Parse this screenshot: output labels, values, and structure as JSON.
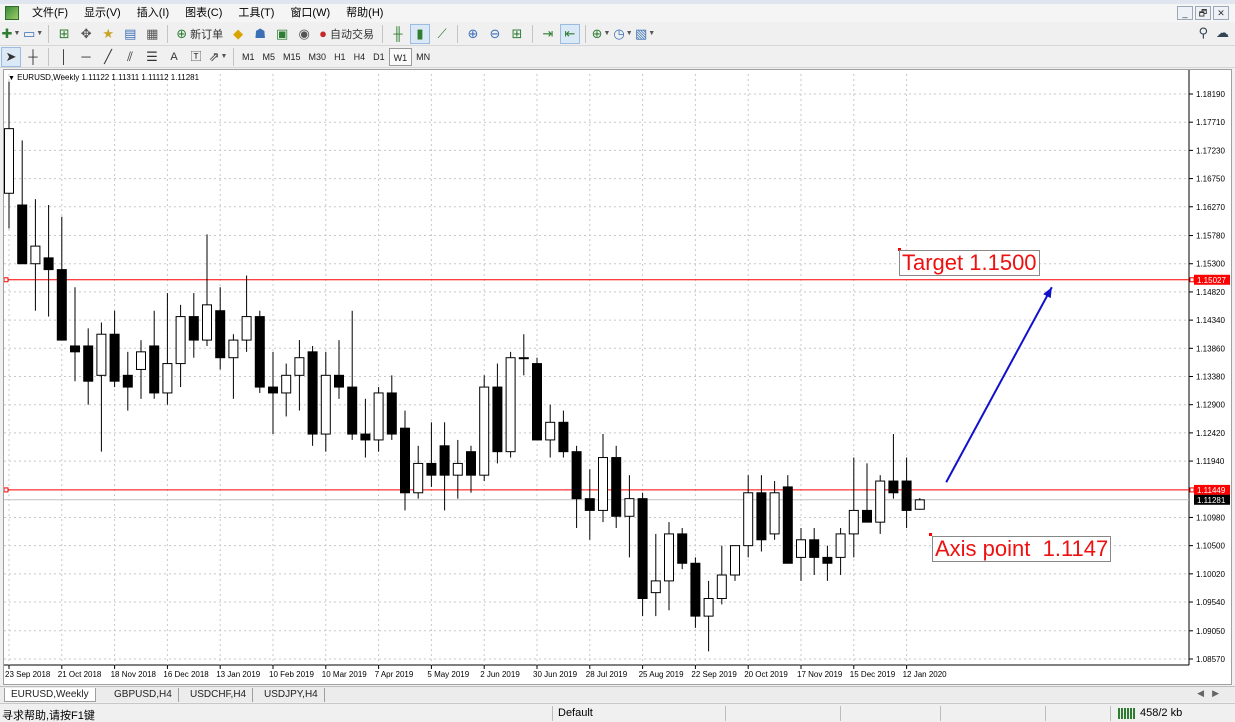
{
  "menubar": {
    "items": [
      "文件(F)",
      "显示(V)",
      "插入(I)",
      "图表(C)",
      "工具(T)",
      "窗口(W)",
      "帮助(H)"
    ]
  },
  "window_controls": [
    "_",
    "🗗",
    "✕"
  ],
  "toolbar1": {
    "new_order_label": "新订单",
    "auto_trading_label": "自动交易"
  },
  "toolbar2": {
    "timeframes": [
      "M1",
      "M5",
      "M15",
      "M30",
      "H1",
      "H4",
      "D1",
      "W1",
      "MN"
    ],
    "selected_timeframe": "W1"
  },
  "chart": {
    "header": "EURUSD,Weekly  1.11122 1.11311 1.11112 1.11281",
    "target_annotation": "Target 1.1500",
    "axis_annotation": "Axis point  1.1147"
  },
  "chart_data": {
    "type": "candlestick",
    "symbol": "EURUSD",
    "timeframe": "Weekly",
    "ohlc_header": {
      "open": 1.11122,
      "high": 1.11311,
      "low": 1.11112,
      "close": 1.11281
    },
    "y_ticks": [
      "1.18190",
      "1.17710",
      "1.17230",
      "1.16750",
      "1.16270",
      "1.15780",
      "1.15300",
      "1.14820",
      "1.14340",
      "1.13860",
      "1.13380",
      "1.12900",
      "1.12420",
      "1.11940",
      "1.10980",
      "1.10500",
      "1.10020",
      "1.09540",
      "1.09050",
      "1.08570"
    ],
    "ylim": [
      1.0857,
      1.1819
    ],
    "x_ticks": [
      "23 Sep 2018",
      "21 Oct 2018",
      "18 Nov 2018",
      "16 Dec 2018",
      "13 Jan 2019",
      "10 Feb 2019",
      "10 Mar 2019",
      "7 Apr 2019",
      "5 May 2019",
      "2 Jun 2019",
      "30 Jun 2019",
      "28 Jul 2019",
      "25 Aug 2019",
      "22 Sep 2019",
      "20 Oct 2019",
      "17 Nov 2019",
      "15 Dec 2019",
      "12 Jan 2020"
    ],
    "x_tick_step_bars": 4,
    "horizontal_lines": [
      {
        "price": 1.15027,
        "label": "1.15027",
        "color": "#ff0000"
      },
      {
        "price": 1.11449,
        "label": "1.11449",
        "color": "#ff0000"
      },
      {
        "price": 1.11281,
        "label": "1.11281",
        "color": "#c0c0c0"
      }
    ],
    "arrow": {
      "from_bar": 71,
      "from_price": 1.1158,
      "to_bar": 79,
      "to_price": 1.149,
      "color": "#1111cc"
    },
    "grid": true,
    "candles": [
      {
        "o": 1.165,
        "h": 1.184,
        "l": 1.159,
        "c": 1.176
      },
      {
        "o": 1.163,
        "h": 1.174,
        "l": 1.153,
        "c": 1.153
      },
      {
        "o": 1.153,
        "h": 1.164,
        "l": 1.145,
        "c": 1.156
      },
      {
        "o": 1.154,
        "h": 1.163,
        "l": 1.144,
        "c": 1.152
      },
      {
        "o": 1.152,
        "h": 1.161,
        "l": 1.145,
        "c": 1.14
      },
      {
        "o": 1.139,
        "h": 1.149,
        "l": 1.133,
        "c": 1.138
      },
      {
        "o": 1.139,
        "h": 1.142,
        "l": 1.129,
        "c": 1.133
      },
      {
        "o": 1.134,
        "h": 1.143,
        "l": 1.121,
        "c": 1.141
      },
      {
        "o": 1.141,
        "h": 1.145,
        "l": 1.132,
        "c": 1.133
      },
      {
        "o": 1.134,
        "h": 1.138,
        "l": 1.128,
        "c": 1.132
      },
      {
        "o": 1.135,
        "h": 1.14,
        "l": 1.13,
        "c": 1.138
      },
      {
        "o": 1.139,
        "h": 1.145,
        "l": 1.13,
        "c": 1.131
      },
      {
        "o": 1.131,
        "h": 1.148,
        "l": 1.129,
        "c": 1.136
      },
      {
        "o": 1.136,
        "h": 1.146,
        "l": 1.132,
        "c": 1.144
      },
      {
        "o": 1.144,
        "h": 1.148,
        "l": 1.137,
        "c": 1.14
      },
      {
        "o": 1.14,
        "h": 1.158,
        "l": 1.139,
        "c": 1.146
      },
      {
        "o": 1.145,
        "h": 1.149,
        "l": 1.135,
        "c": 1.137
      },
      {
        "o": 1.137,
        "h": 1.141,
        "l": 1.13,
        "c": 1.14
      },
      {
        "o": 1.14,
        "h": 1.151,
        "l": 1.138,
        "c": 1.144
      },
      {
        "o": 1.144,
        "h": 1.145,
        "l": 1.131,
        "c": 1.132
      },
      {
        "o": 1.132,
        "h": 1.138,
        "l": 1.124,
        "c": 1.131
      },
      {
        "o": 1.131,
        "h": 1.136,
        "l": 1.127,
        "c": 1.134
      },
      {
        "o": 1.134,
        "h": 1.14,
        "l": 1.128,
        "c": 1.137
      },
      {
        "o": 1.138,
        "h": 1.139,
        "l": 1.122,
        "c": 1.124
      },
      {
        "o": 1.124,
        "h": 1.138,
        "l": 1.121,
        "c": 1.134
      },
      {
        "o": 1.134,
        "h": 1.14,
        "l": 1.13,
        "c": 1.132
      },
      {
        "o": 1.132,
        "h": 1.145,
        "l": 1.123,
        "c": 1.124
      },
      {
        "o": 1.124,
        "h": 1.13,
        "l": 1.12,
        "c": 1.123
      },
      {
        "o": 1.123,
        "h": 1.132,
        "l": 1.121,
        "c": 1.131
      },
      {
        "o": 1.131,
        "h": 1.134,
        "l": 1.123,
        "c": 1.124
      },
      {
        "o": 1.125,
        "h": 1.128,
        "l": 1.111,
        "c": 1.114
      },
      {
        "o": 1.114,
        "h": 1.122,
        "l": 1.113,
        "c": 1.119
      },
      {
        "o": 1.119,
        "h": 1.126,
        "l": 1.115,
        "c": 1.117
      },
      {
        "o": 1.122,
        "h": 1.126,
        "l": 1.111,
        "c": 1.117
      },
      {
        "o": 1.117,
        "h": 1.123,
        "l": 1.113,
        "c": 1.119
      },
      {
        "o": 1.121,
        "h": 1.122,
        "l": 1.114,
        "c": 1.117
      },
      {
        "o": 1.117,
        "h": 1.134,
        "l": 1.116,
        "c": 1.132
      },
      {
        "o": 1.132,
        "h": 1.136,
        "l": 1.119,
        "c": 1.121
      },
      {
        "o": 1.121,
        "h": 1.138,
        "l": 1.12,
        "c": 1.137
      },
      {
        "o": 1.137,
        "h": 1.141,
        "l": 1.134,
        "c": 1.137
      },
      {
        "o": 1.136,
        "h": 1.137,
        "l": 1.123,
        "c": 1.123
      },
      {
        "o": 1.123,
        "h": 1.129,
        "l": 1.12,
        "c": 1.126
      },
      {
        "o": 1.126,
        "h": 1.128,
        "l": 1.12,
        "c": 1.121
      },
      {
        "o": 1.121,
        "h": 1.122,
        "l": 1.108,
        "c": 1.113
      },
      {
        "o": 1.113,
        "h": 1.118,
        "l": 1.106,
        "c": 1.111
      },
      {
        "o": 1.111,
        "h": 1.124,
        "l": 1.109,
        "c": 1.12
      },
      {
        "o": 1.12,
        "h": 1.122,
        "l": 1.108,
        "c": 1.11
      },
      {
        "o": 1.11,
        "h": 1.117,
        "l": 1.103,
        "c": 1.113
      },
      {
        "o": 1.113,
        "h": 1.114,
        "l": 1.093,
        "c": 1.096
      },
      {
        "o": 1.097,
        "h": 1.107,
        "l": 1.093,
        "c": 1.099
      },
      {
        "o": 1.099,
        "h": 1.109,
        "l": 1.094,
        "c": 1.107
      },
      {
        "o": 1.107,
        "h": 1.108,
        "l": 1.101,
        "c": 1.102
      },
      {
        "o": 1.102,
        "h": 1.103,
        "l": 1.091,
        "c": 1.093
      },
      {
        "o": 1.093,
        "h": 1.099,
        "l": 1.087,
        "c": 1.096
      },
      {
        "o": 1.096,
        "h": 1.105,
        "l": 1.095,
        "c": 1.1
      },
      {
        "o": 1.1,
        "h": 1.104,
        "l": 1.099,
        "c": 1.105
      },
      {
        "o": 1.105,
        "h": 1.117,
        "l": 1.103,
        "c": 1.114
      },
      {
        "o": 1.114,
        "h": 1.117,
        "l": 1.104,
        "c": 1.106
      },
      {
        "o": 1.107,
        "h": 1.116,
        "l": 1.106,
        "c": 1.114
      },
      {
        "o": 1.115,
        "h": 1.117,
        "l": 1.102,
        "c": 1.102
      },
      {
        "o": 1.103,
        "h": 1.108,
        "l": 1.099,
        "c": 1.106
      },
      {
        "o": 1.106,
        "h": 1.108,
        "l": 1.1,
        "c": 1.103
      },
      {
        "o": 1.103,
        "h": 1.105,
        "l": 1.099,
        "c": 1.102
      },
      {
        "o": 1.103,
        "h": 1.108,
        "l": 1.1,
        "c": 1.107
      },
      {
        "o": 1.107,
        "h": 1.12,
        "l": 1.103,
        "c": 1.111
      },
      {
        "o": 1.111,
        "h": 1.119,
        "l": 1.109,
        "c": 1.109
      },
      {
        "o": 1.109,
        "h": 1.117,
        "l": 1.107,
        "c": 1.116
      },
      {
        "o": 1.116,
        "h": 1.124,
        "l": 1.113,
        "c": 1.114
      },
      {
        "o": 1.116,
        "h": 1.12,
        "l": 1.108,
        "c": 1.111
      },
      {
        "o": 1.1112,
        "h": 1.1131,
        "l": 1.1111,
        "c": 1.1128
      }
    ]
  },
  "tabs": [
    "EURUSD,Weekly",
    "GBPUSD,H4",
    "USDCHF,H4",
    "USDJPY,H4"
  ],
  "active_tab_index": 0,
  "statusbar": {
    "help": "寻求帮助,请按F1键",
    "profile": "Default",
    "traffic": "458/2 kb"
  }
}
